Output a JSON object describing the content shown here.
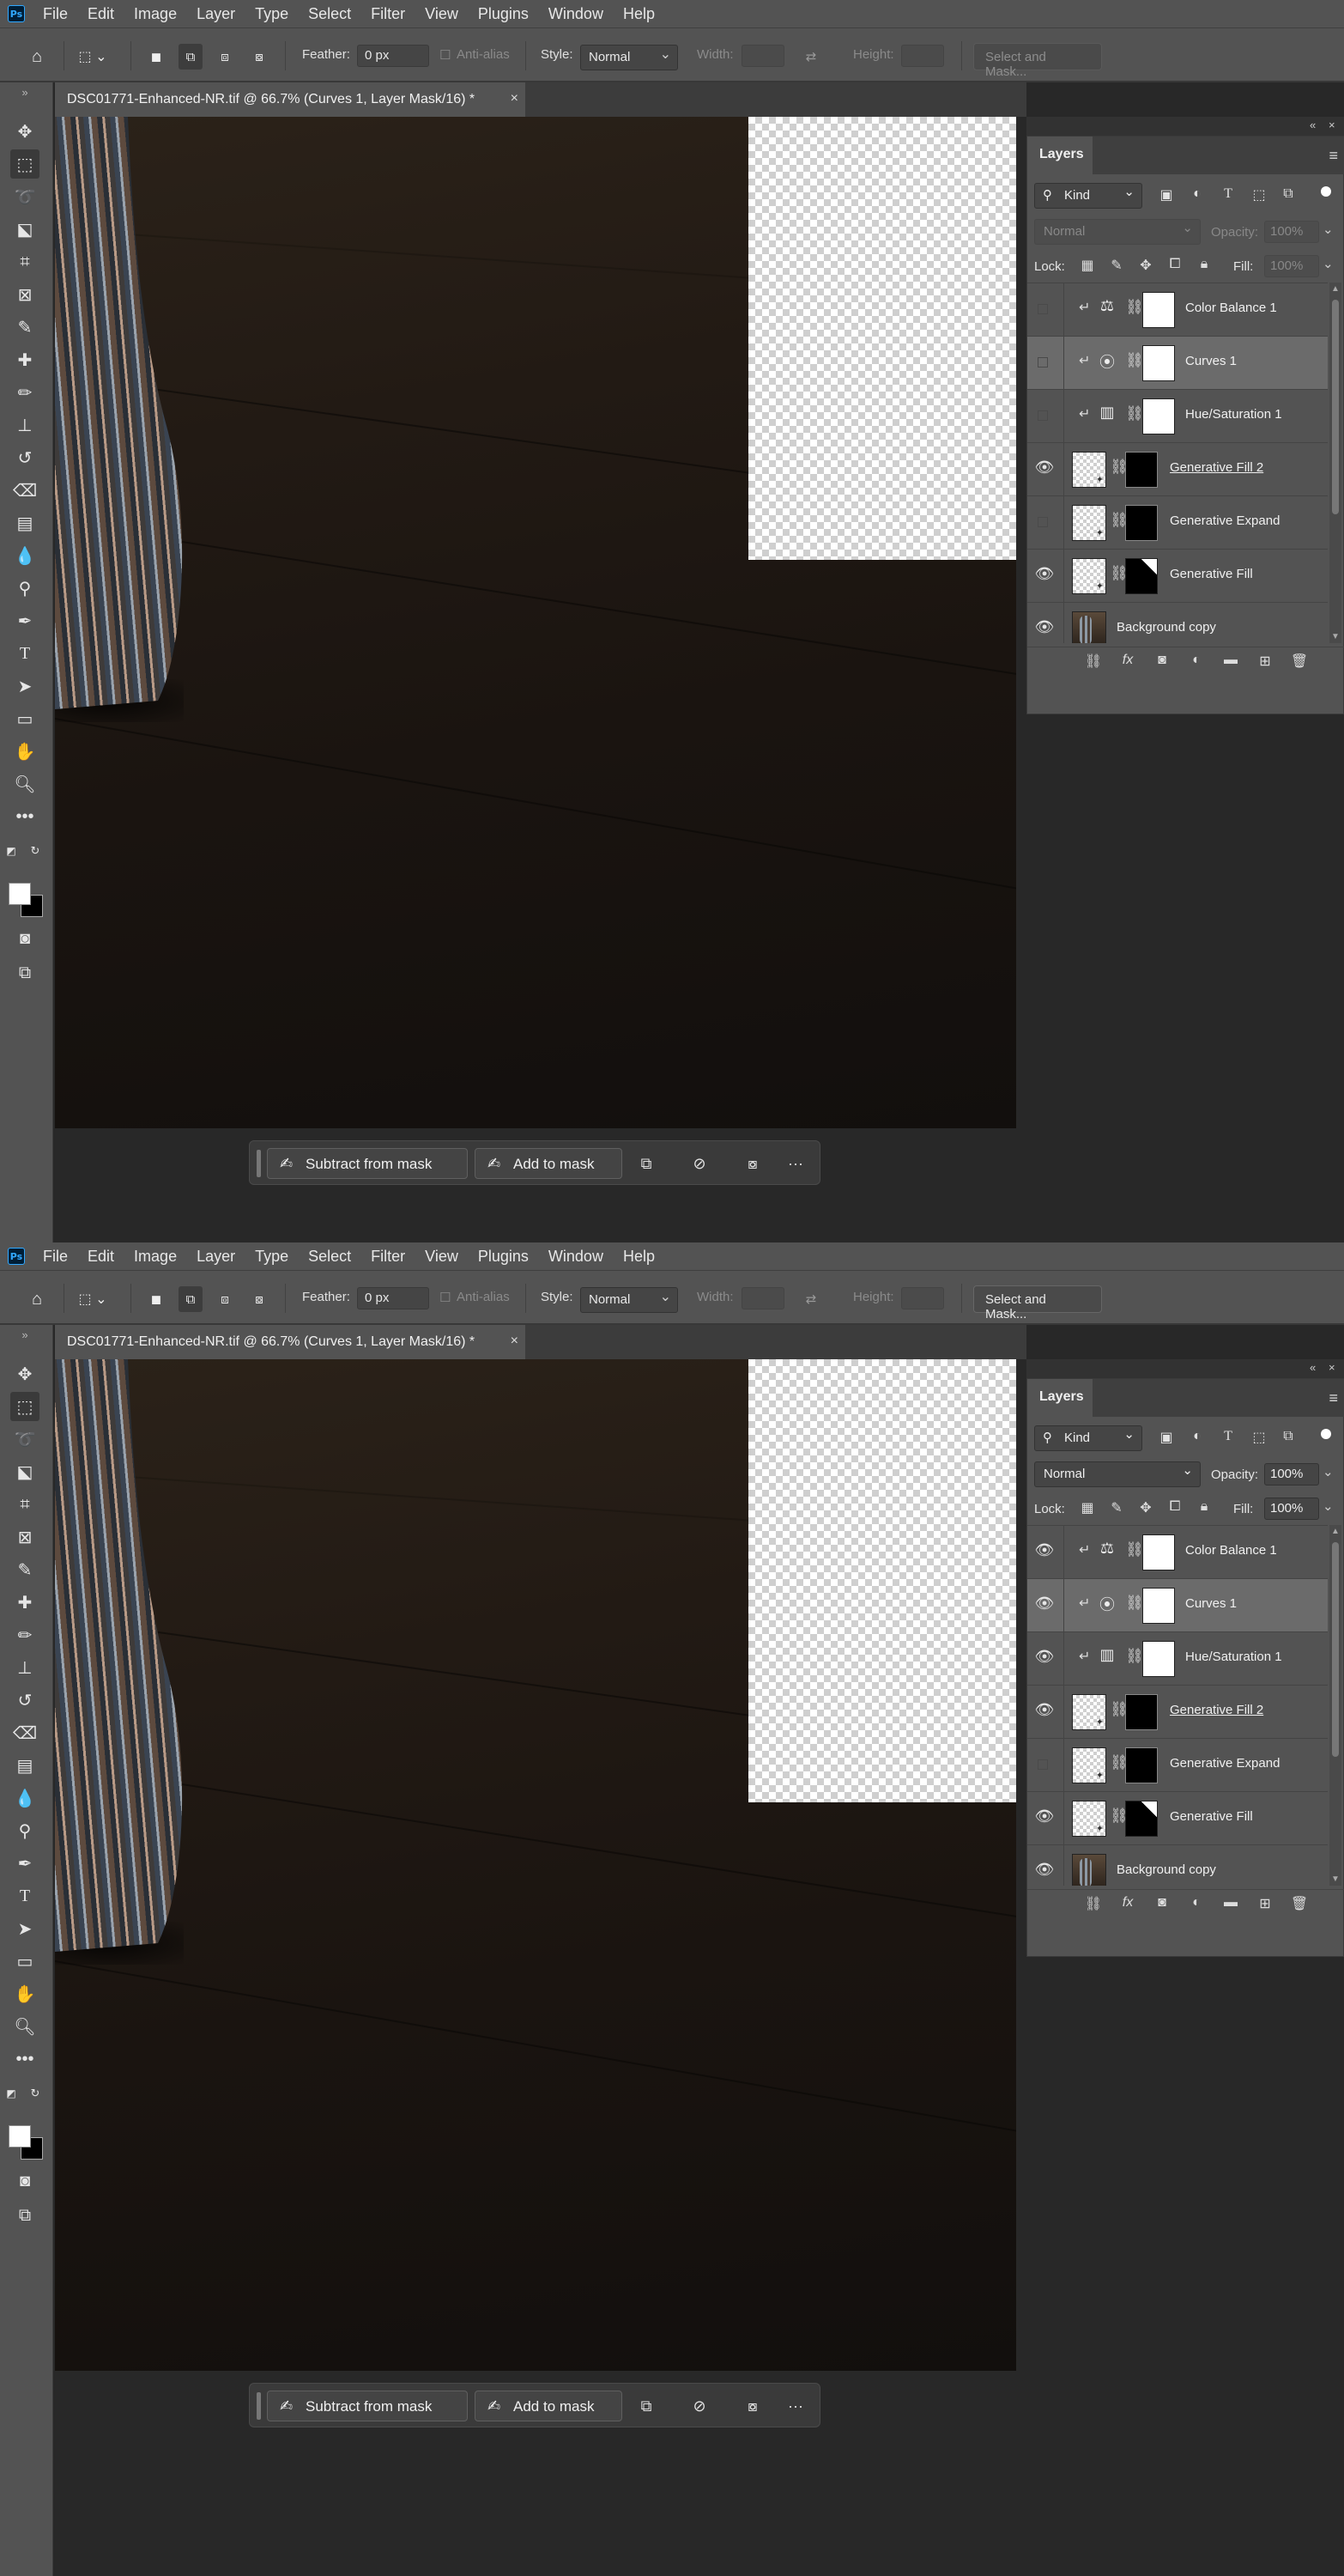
{
  "menu": [
    "File",
    "Edit",
    "Image",
    "Layer",
    "Type",
    "Select",
    "Filter",
    "View",
    "Plugins",
    "Window",
    "Help"
  ],
  "app_logo": "Ps",
  "options": {
    "feather_label": "Feather:",
    "feather_value": "0 px",
    "antialias_label": "Anti-alias",
    "style_label": "Style:",
    "style_value": "Normal",
    "width_label": "Width:",
    "height_label": "Height:",
    "select_and_mask": "Select and Mask..."
  },
  "document_tab": {
    "title": "DSC01771-Enhanced-NR.tif @ 66.7% (Curves 1, Layer Mask/16) *",
    "close": "×"
  },
  "taskbar": {
    "subtract": "Subtract from mask",
    "add": "Add to mask",
    "more": "···"
  },
  "panel": {
    "collapse": "«",
    "close": "×",
    "tab": "Layers",
    "menu_icon": "≡",
    "kind": "Kind",
    "blend_mode": "Normal",
    "opacity_label": "Opacity:",
    "opacity_value": "100%",
    "lock_label": "Lock:",
    "fill_label": "Fill:",
    "fill_value": "100%"
  },
  "screens": [
    {
      "state": "disabled-options",
      "layers": [
        {
          "name": "Color Balance 1",
          "visible": false,
          "icon": "balance-icon",
          "selected": false
        },
        {
          "name": "Curves 1",
          "visible": false,
          "icon": "curves-icon",
          "selected": true
        },
        {
          "name": "Hue/Saturation 1",
          "visible": false,
          "icon": "hue-saturation-icon",
          "selected": false
        },
        {
          "name": "Generative Fill 2",
          "visible": true,
          "icon": "generative",
          "selected": false
        },
        {
          "name": "Generative Expand",
          "visible": false,
          "icon": "generative",
          "selected": false
        },
        {
          "name": "Generative Fill",
          "visible": true,
          "icon": "generative",
          "selected": false
        },
        {
          "name": "Background copy",
          "visible": true,
          "icon": "photo",
          "selected": false
        }
      ]
    },
    {
      "state": "enabled-options",
      "layers": [
        {
          "name": "Color Balance 1",
          "visible": true,
          "icon": "balance-icon",
          "selected": false
        },
        {
          "name": "Curves 1",
          "visible": true,
          "icon": "curves-icon",
          "selected": true
        },
        {
          "name": "Hue/Saturation 1",
          "visible": true,
          "icon": "hue-saturation-icon",
          "selected": false
        },
        {
          "name": "Generative Fill 2",
          "visible": true,
          "icon": "generative",
          "selected": false
        },
        {
          "name": "Generative Expand",
          "visible": false,
          "icon": "generative",
          "selected": false
        },
        {
          "name": "Generative Fill",
          "visible": true,
          "icon": "generative",
          "selected": false
        },
        {
          "name": "Background copy",
          "visible": true,
          "icon": "photo",
          "selected": false
        }
      ]
    }
  ]
}
